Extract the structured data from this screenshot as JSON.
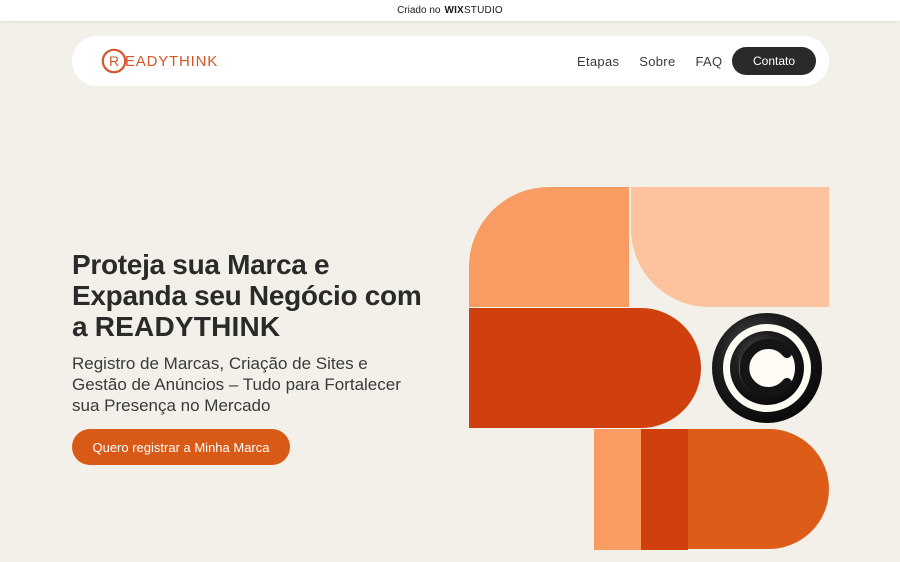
{
  "wix_banner": {
    "prefix": "Criado no",
    "brand_bold": "WIX",
    "brand_light": "STUDIO"
  },
  "header": {
    "logo": {
      "text": "EADYTHINK",
      "mark_letter": "R"
    },
    "nav": [
      {
        "label": "Etapas"
      },
      {
        "label": "Sobre"
      },
      {
        "label": "FAQ"
      }
    ],
    "contact_label": "Contato"
  },
  "hero": {
    "headline_line1": "Proteja sua Marca e",
    "headline_line2": "Expanda seu Negócio com",
    "headline_line3_prefix": "a ",
    "headline_brand": "READYTHINK",
    "subheadline_line1": "Registro de Marcas, Criação de Sites e",
    "subheadline_line2": "Gestão de Anúncios – Tudo para Fortalecer",
    "subheadline_line3": "sua Presença no Mercado",
    "cta_label": "Quero registrar a Minha Marca"
  },
  "colors": {
    "background": "#f2f0e9",
    "accent_orange": "#d85a16",
    "light_orange": "#f89c63",
    "peach": "#fdc39e",
    "deep_orange": "#d0400e",
    "dark": "#2b2a28"
  },
  "icons": {
    "logo_mark": "registered-icon",
    "art_symbol": "copyright-icon"
  }
}
